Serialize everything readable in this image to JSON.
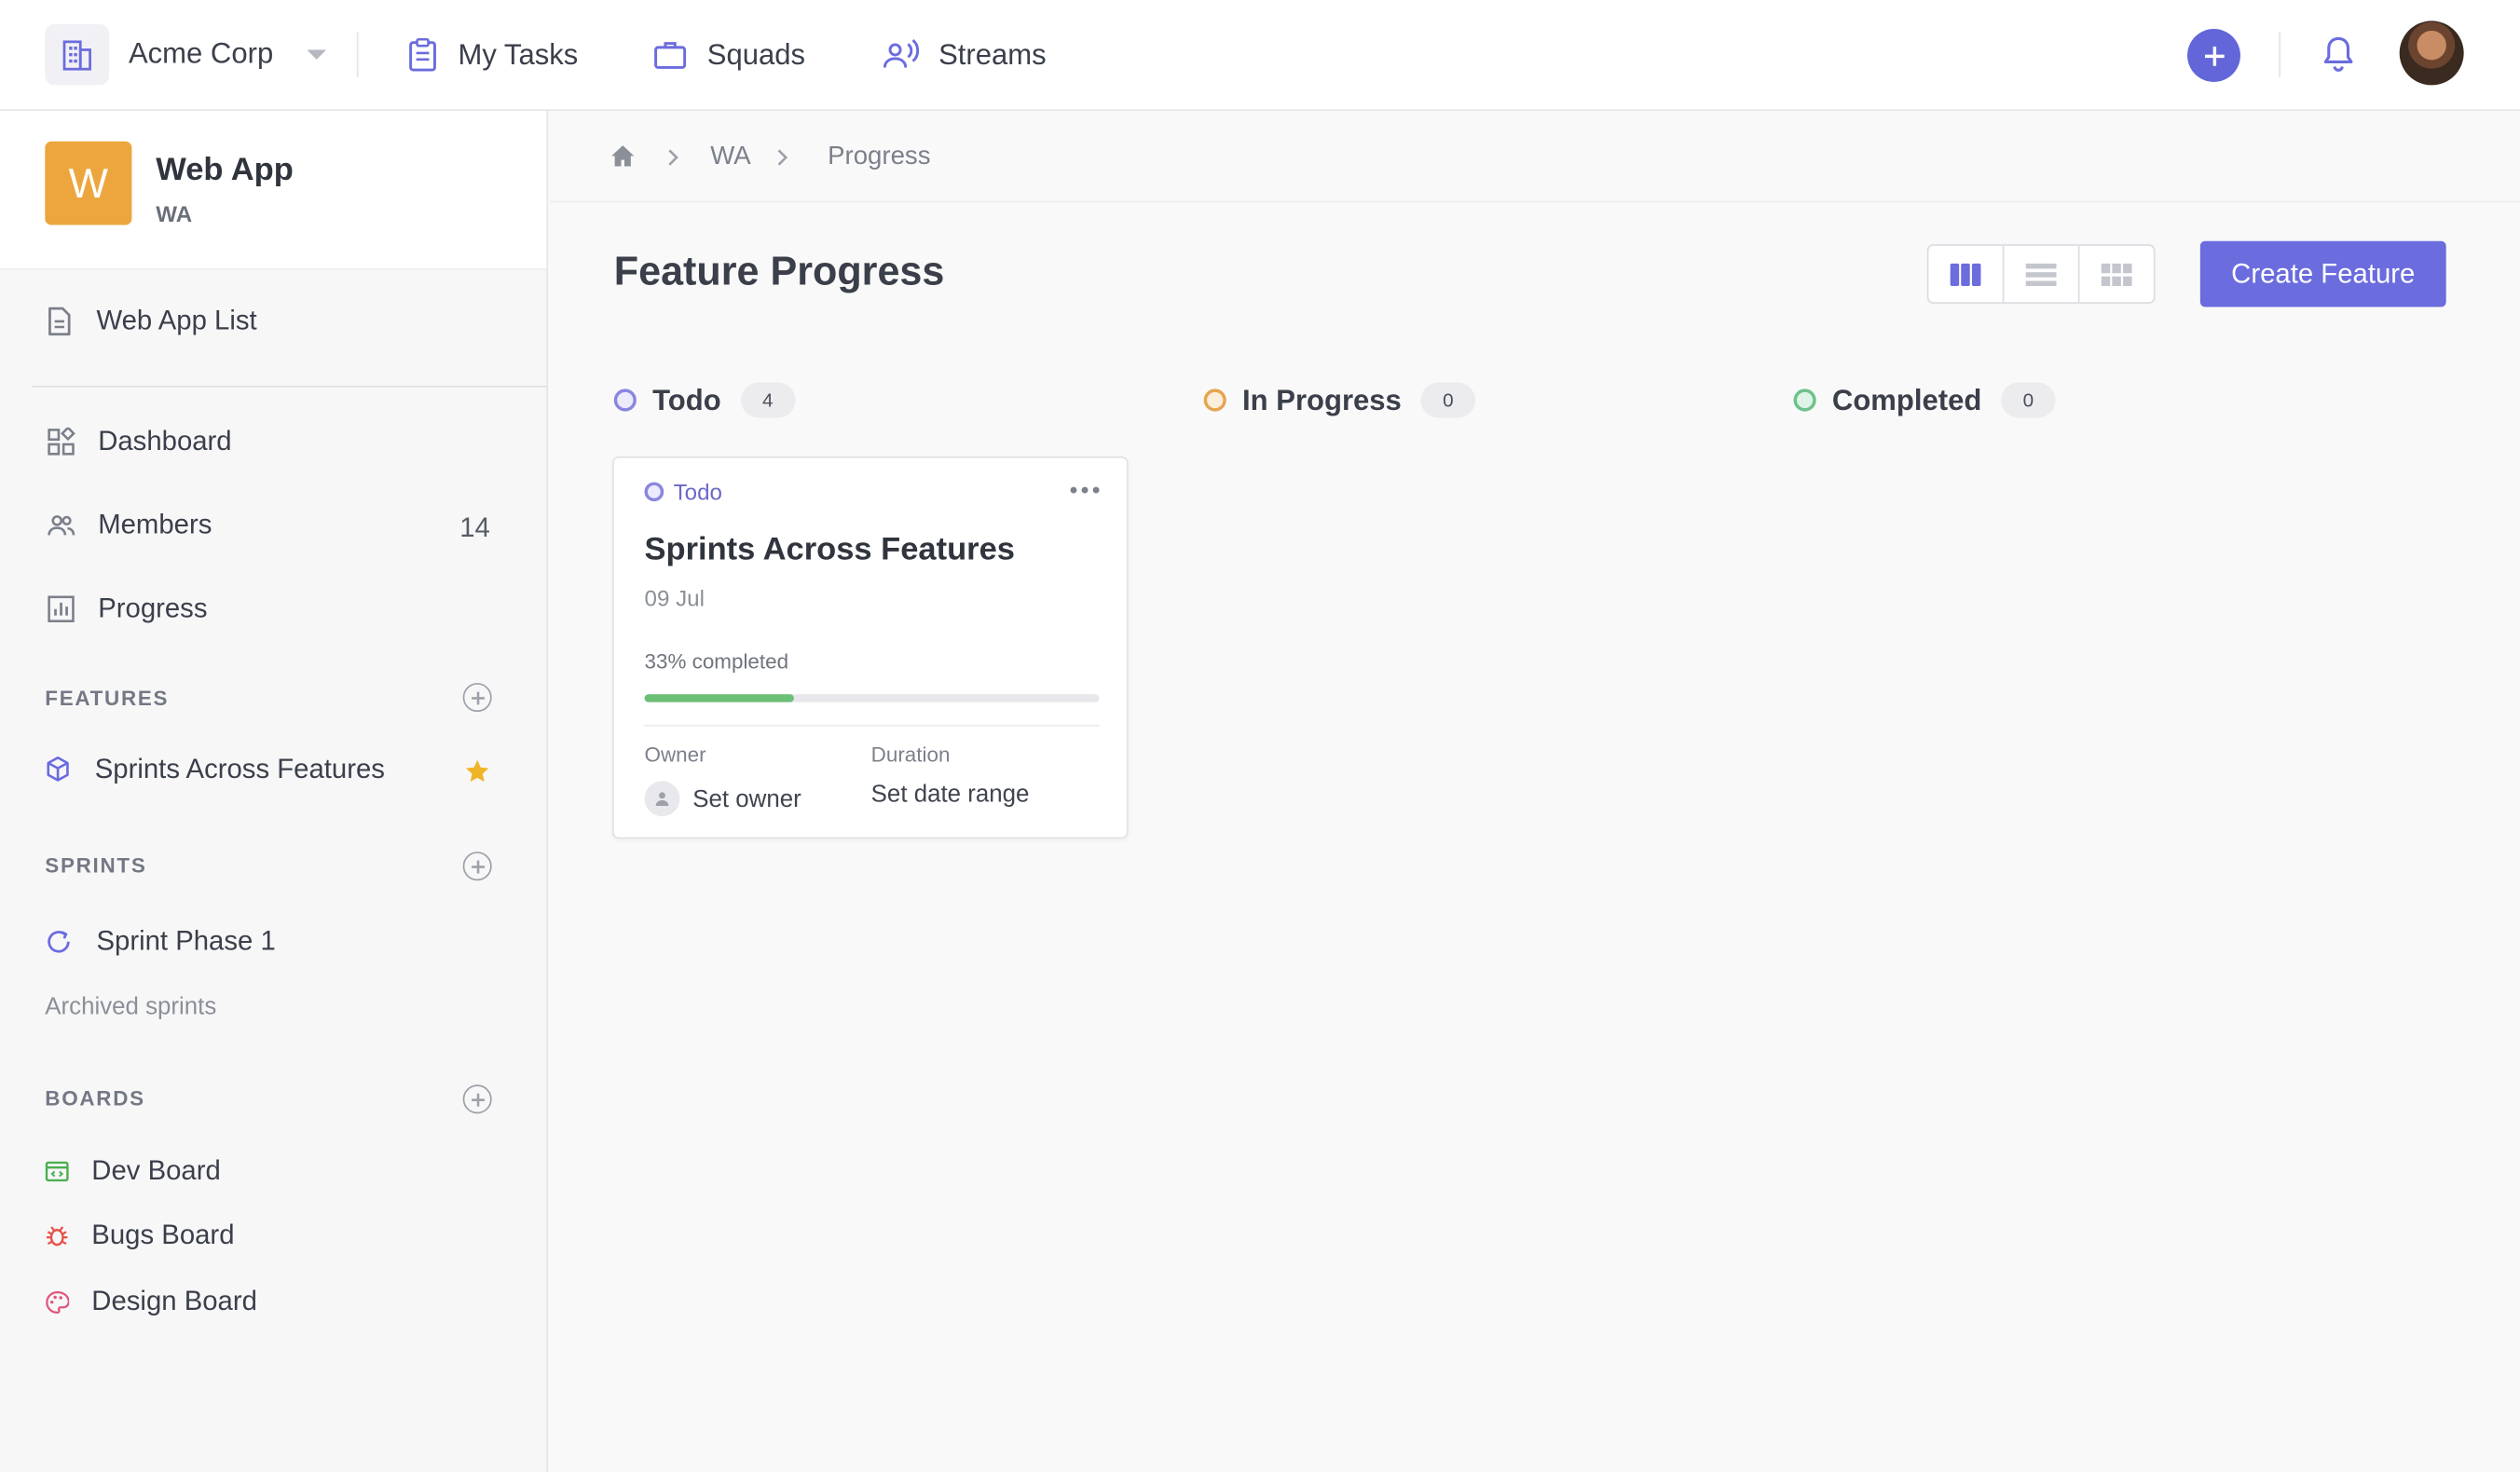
{
  "topbar": {
    "workspace": "Acme Corp",
    "nav": [
      {
        "label": "My Tasks",
        "icon": "clipboard-icon"
      },
      {
        "label": "Squads",
        "icon": "briefcase-icon"
      },
      {
        "label": "Streams",
        "icon": "stream-icon"
      }
    ]
  },
  "project": {
    "logo_letter": "W",
    "name": "Web App",
    "key": "WA",
    "logo_color": "#eca63d"
  },
  "sidebar": {
    "list_link": "Web App List",
    "nav": [
      {
        "label": "Dashboard"
      },
      {
        "label": "Members",
        "count": "14"
      },
      {
        "label": "Progress"
      }
    ],
    "features_label": "FEATURES",
    "features": [
      {
        "label": "Sprints Across Features",
        "starred": true
      }
    ],
    "sprints_label": "SPRINTS",
    "sprints": [
      {
        "label": "Sprint Phase 1"
      }
    ],
    "archived_label": "Archived sprints",
    "boards_label": "BOARDS",
    "boards": [
      {
        "label": "Dev Board",
        "color": "#4caf50"
      },
      {
        "label": "Bugs Board",
        "color": "#e5534b"
      },
      {
        "label": "Design Board",
        "color": "#e0567a"
      }
    ]
  },
  "breadcrumb": {
    "items": [
      "WA",
      "Progress"
    ]
  },
  "main": {
    "title": "Feature Progress",
    "create_label": "Create Feature",
    "accent": "#6b6cde",
    "columns": [
      {
        "label": "Todo",
        "count": "4",
        "color": "#8a86e0"
      },
      {
        "label": "In Progress",
        "count": "0",
        "color": "#e5a54f"
      },
      {
        "label": "Completed",
        "count": "0",
        "color": "#6cc28a"
      }
    ],
    "card": {
      "status": "Todo",
      "title": "Sprints Across Features",
      "date": "09 Jul",
      "progress_text": "33% completed",
      "progress_fraction": 0.33,
      "owner_label": "Owner",
      "owner_value": "Set owner",
      "duration_label": "Duration",
      "duration_value": "Set date range"
    }
  }
}
